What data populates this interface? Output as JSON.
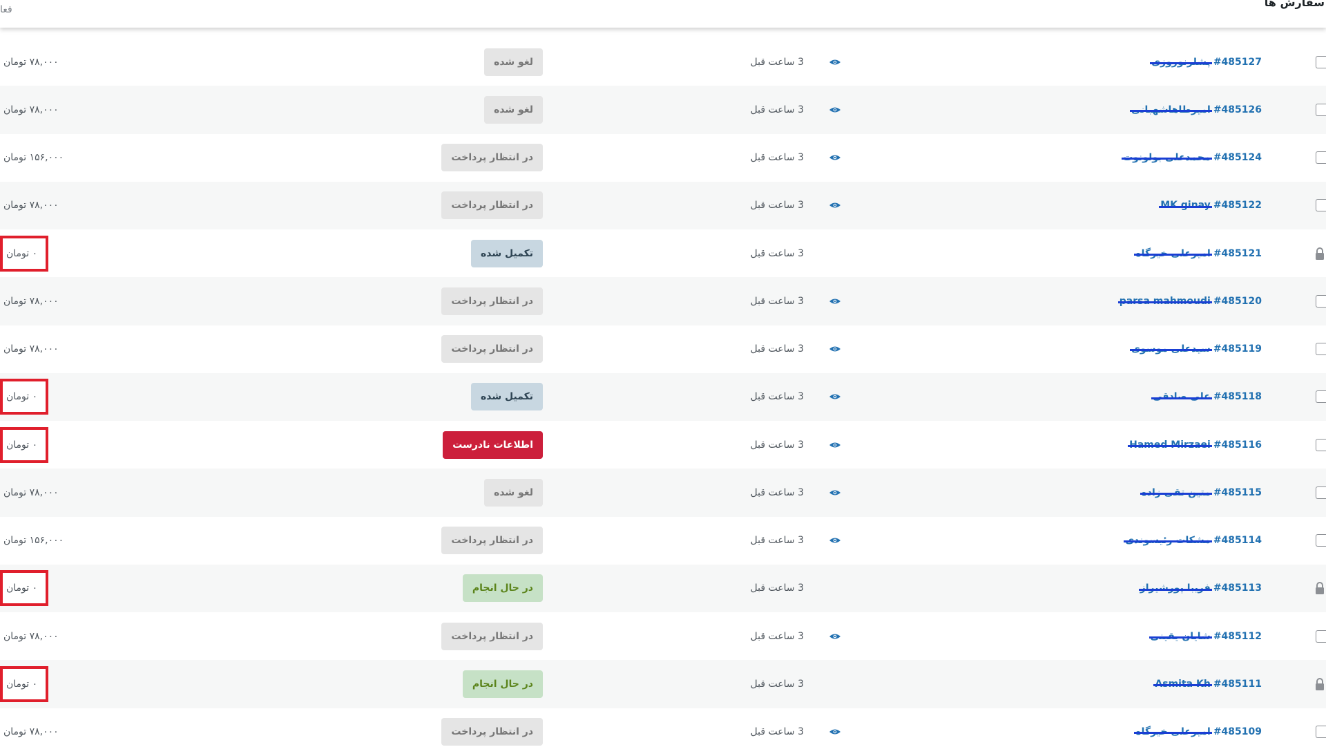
{
  "header": {
    "left_text": "فعا",
    "right_text": "سفارش ها"
  },
  "colors": {
    "link": "#2271b1",
    "highlight_border": "#e01f2c",
    "status_failed": "#cc1f3b"
  },
  "orders": [
    {
      "id": "#485127",
      "customer": "پشلرنوروزی",
      "date": "3 ساعت قبل",
      "preview": true,
      "status": "لغو شده",
      "status_type": "cancelled",
      "total": "۷۸,۰۰۰ تومان",
      "locked": false,
      "flagged": false
    },
    {
      "id": "#485126",
      "customer": "امیرطاهاشهبانی",
      "date": "3 ساعت قبل",
      "preview": true,
      "status": "لغو شده",
      "status_type": "cancelled",
      "total": "۷۸,۰۰۰ تومان",
      "locked": false,
      "flagged": false
    },
    {
      "id": "#485124",
      "customer": "محمدعلی بولونوت",
      "date": "3 ساعت قبل",
      "preview": true,
      "status": "در انتظار پرداخت",
      "status_type": "pending",
      "total": "۱۵۶,۰۰۰ تومان",
      "locked": false,
      "flagged": false
    },
    {
      "id": "#485122",
      "customer": "MK ginay",
      "date": "3 ساعت قبل",
      "preview": true,
      "status": "در انتظار پرداخت",
      "status_type": "pending",
      "total": "۷۸,۰۰۰ تومان",
      "locked": false,
      "flagged": false
    },
    {
      "id": "#485121",
      "customer": "امیرعلی خیرگاه",
      "date": "3 ساعت قبل",
      "preview": false,
      "status": "تکمیل شده",
      "status_type": "completed",
      "total": "۰ تومان",
      "locked": true,
      "flagged": true
    },
    {
      "id": "#485120",
      "customer": "parsa mahmoudi",
      "date": "3 ساعت قبل",
      "preview": true,
      "status": "در انتظار پرداخت",
      "status_type": "pending",
      "total": "۷۸,۰۰۰ تومان",
      "locked": false,
      "flagged": false
    },
    {
      "id": "#485119",
      "customer": "سیدعلی موسوی",
      "date": "3 ساعت قبل",
      "preview": true,
      "status": "در انتظار پرداخت",
      "status_type": "pending",
      "total": "۷۸,۰۰۰ تومان",
      "locked": false,
      "flagged": false
    },
    {
      "id": "#485118",
      "customer": "علی صادقی",
      "date": "3 ساعت قبل",
      "preview": true,
      "status": "تکمیل شده",
      "status_type": "completed",
      "total": "۰ تومان",
      "locked": false,
      "flagged": true
    },
    {
      "id": "#485116",
      "customer": "Hamed Mirzaei",
      "date": "3 ساعت قبل",
      "preview": true,
      "status": "اطلاعات نادرست",
      "status_type": "failed",
      "total": "۰ تومان",
      "locked": false,
      "flagged": true
    },
    {
      "id": "#485115",
      "customer": "متین تقی زاده",
      "date": "3 ساعت قبل",
      "preview": true,
      "status": "لغو شده",
      "status_type": "cancelled",
      "total": "۷۸,۰۰۰ تومان",
      "locked": false,
      "flagged": false
    },
    {
      "id": "#485114",
      "customer": "مشکات رئیسوندی",
      "date": "3 ساعت قبل",
      "preview": true,
      "status": "در انتظار پرداخت",
      "status_type": "pending",
      "total": "۱۵۶,۰۰۰ تومان",
      "locked": false,
      "flagged": false
    },
    {
      "id": "#485113",
      "customer": "فریبا پورشیراز",
      "date": "3 ساعت قبل",
      "preview": false,
      "status": "در حال انجام",
      "status_type": "processing",
      "total": "۰ تومان",
      "locked": true,
      "flagged": true
    },
    {
      "id": "#485112",
      "customer": "شایان یقینی",
      "date": "3 ساعت قبل",
      "preview": true,
      "status": "در انتظار پرداخت",
      "status_type": "pending",
      "total": "۷۸,۰۰۰ تومان",
      "locked": false,
      "flagged": false
    },
    {
      "id": "#485111",
      "customer": "Asmita Kh",
      "date": "3 ساعت قبل",
      "preview": false,
      "status": "در حال انجام",
      "status_type": "processing",
      "total": "۰ تومان",
      "locked": true,
      "flagged": true
    },
    {
      "id": "#485109",
      "customer": "امیرعلی خیرگاه",
      "date": "3 ساعت قبل",
      "preview": true,
      "status": "در انتظار پرداخت",
      "status_type": "pending",
      "total": "۷۸,۰۰۰ تومان",
      "locked": false,
      "flagged": false
    }
  ]
}
